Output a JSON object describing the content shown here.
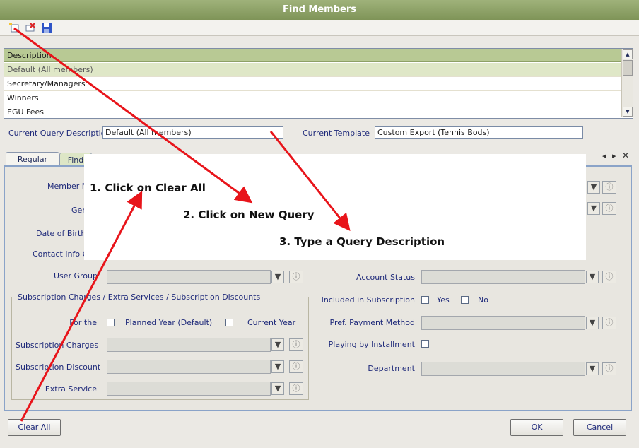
{
  "window": {
    "title": "Find Members"
  },
  "toolbar": {
    "icons": [
      "new-query-icon",
      "clear-icon",
      "save-icon"
    ]
  },
  "queries": {
    "header": "Description",
    "rows": [
      "Default (All members)",
      "Secretary/Managers",
      "Winners",
      "EGU Fees"
    ]
  },
  "current_query": {
    "label": "Current Query Description",
    "value": "Default (All members)"
  },
  "current_template": {
    "label": "Current Template",
    "value": "Custom Export   (Tennis Bods)"
  },
  "tabs": [
    "Regular",
    "Find"
  ],
  "form": {
    "member_name_label": "Member Na",
    "gender_label": "Gen",
    "dob_label": "Date of Birth F",
    "contact_group_label": "Contact Info Gr",
    "user_group_label": "User Group",
    "account_status_label": "Account Status",
    "included_label": "Included in Subscription",
    "yes_label": "Yes",
    "no_label": "No",
    "pref_payment_label": "Pref. Payment Method",
    "installment_label": "Playing by Installment",
    "department_label": "Department"
  },
  "subscription_group": {
    "title": "Subscription Charges  /  Extra Services  /  Subscription Discounts",
    "for_the_label": "For the",
    "planned_year_label": "Planned Year (Default)",
    "current_year_label": "Current Year",
    "charges_label": "Subscription Charges",
    "discount_label": "Subscription Discount",
    "extra_service_label": "Extra Service"
  },
  "buttons": {
    "clear_all": "Clear All",
    "ok": "OK",
    "cancel": "Cancel"
  },
  "annotations": {
    "step1": "1. Click on Clear All",
    "step2": "2. Click on New Query",
    "step3": "3. Type a Query Description"
  },
  "colors": {
    "title_bar": "#8aa063",
    "grid_header": "#b8c994",
    "arrow": "#e8141a",
    "panel_border": "#8aa3c8"
  }
}
